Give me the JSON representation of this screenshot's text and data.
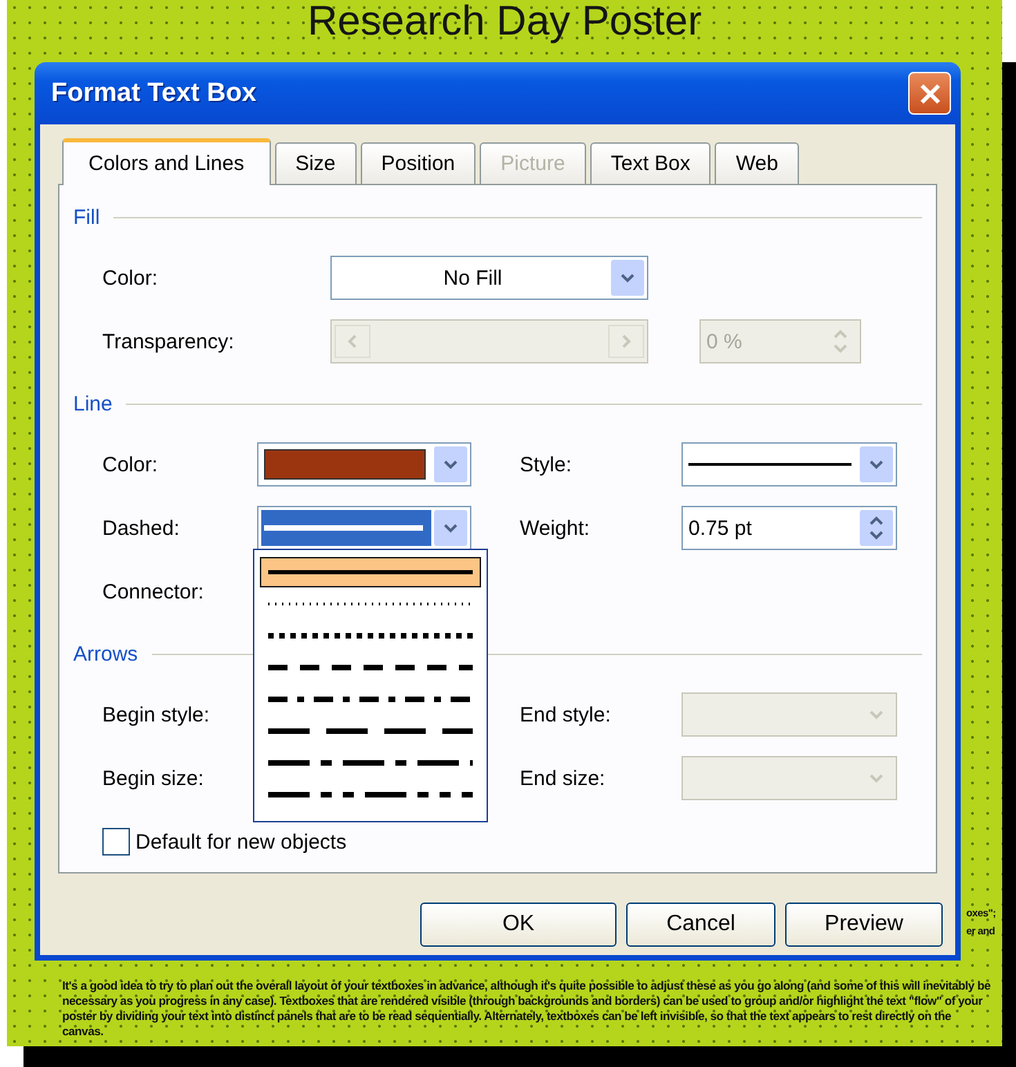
{
  "poster": {
    "title": "Research Day Poster",
    "paragraph": "It's a good idea to try to plan out the overall layout of your textboxes in advance, although it's quite possible to adjust these as you go along (and some of this will inevitably be necessary as you progress in any case). Textboxes that are rendered visible (through backgrounds and borders) can be used to group and/or highlight the text \"flow\" of your poster by dividing your text into distinct panels that are to be read sequentially. Alternately, textboxes can be left invisible, so that the text appears to rest directly on the canvas.",
    "fragments": [
      "oxes\";",
      "er and"
    ]
  },
  "dialog": {
    "title": "Format Text Box",
    "tabs": [
      {
        "label": "Colors and Lines",
        "selected": true,
        "disabled": false
      },
      {
        "label": "Size",
        "selected": false,
        "disabled": false
      },
      {
        "label": "Position",
        "selected": false,
        "disabled": false
      },
      {
        "label": "Picture",
        "selected": false,
        "disabled": true
      },
      {
        "label": "Text Box",
        "selected": false,
        "disabled": false
      },
      {
        "label": "Web",
        "selected": false,
        "disabled": false
      }
    ],
    "sections": [
      {
        "title": "Fill",
        "rows": [
          {
            "fields": [
              {
                "label": "Color:",
                "kind": "combo",
                "value": "No Fill",
                "disabled": false
              }
            ]
          },
          {
            "fields": [
              {
                "label": "Transparency:",
                "kind": "slider",
                "disabled": true,
                "spin_value": "0 %"
              }
            ]
          }
        ]
      },
      {
        "title": "Line",
        "rows": [
          {
            "fields": [
              {
                "label": "Color:",
                "kind": "color",
                "color": "#9b3510",
                "disabled": false
              },
              {
                "label": "Style:",
                "kind": "line",
                "disabled": false
              }
            ]
          },
          {
            "fields": [
              {
                "label": "Dashed:",
                "kind": "dash",
                "open": true,
                "disabled": false
              },
              {
                "label": "Weight:",
                "kind": "spin",
                "value": "0.75 pt",
                "disabled": false
              }
            ]
          },
          {
            "fields": [
              {
                "label": "Connector:",
                "kind": "hidden"
              }
            ]
          }
        ]
      },
      {
        "title": "Arrows",
        "rows": [
          {
            "fields": [
              {
                "label": "Begin style:",
                "kind": "hidden"
              },
              {
                "label": "End style:",
                "kind": "combo",
                "disabled": true
              }
            ]
          },
          {
            "fields": [
              {
                "label": "Begin size:",
                "kind": "hidden"
              },
              {
                "label": "End size:",
                "kind": "combo",
                "disabled": true
              }
            ]
          }
        ]
      }
    ],
    "checkbox": {
      "label": "Default for new objects",
      "checked": false
    },
    "dash_list": [
      {
        "kind": "solid",
        "selected": true
      },
      {
        "kind": "round-dot",
        "selected": false
      },
      {
        "kind": "square-dot",
        "selected": false
      },
      {
        "kind": "dash",
        "selected": false
      },
      {
        "kind": "dash-dot",
        "selected": false
      },
      {
        "kind": "long-dash",
        "selected": false
      },
      {
        "kind": "long-dash-dot",
        "selected": false
      },
      {
        "kind": "long-dash-dot-dot",
        "selected": false
      }
    ],
    "buttons": [
      "OK",
      "Cancel",
      "Preview"
    ]
  }
}
